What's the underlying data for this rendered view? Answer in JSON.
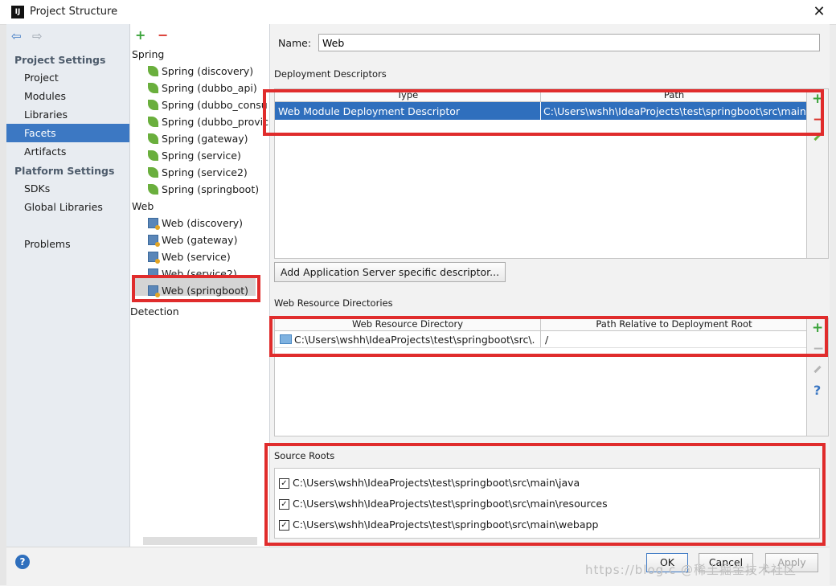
{
  "window": {
    "title": "Project Structure",
    "close_glyph": "✕",
    "app_icon_text": "IJ"
  },
  "nav": {
    "back_glyph": "⇦",
    "forward_glyph": "⇨",
    "project_settings_header": "Project Settings",
    "project_settings_items": [
      "Project",
      "Modules",
      "Libraries",
      "Facets",
      "Artifacts"
    ],
    "platform_settings_header": "Platform Settings",
    "platform_settings_items": [
      "SDKs",
      "Global Libraries"
    ],
    "problems": "Problems",
    "selected": "Facets"
  },
  "tree": {
    "add_glyph": "+",
    "remove_glyph": "−",
    "groups": [
      {
        "label": "Spring",
        "items": [
          "Spring (discovery)",
          "Spring (dubbo_api)",
          "Spring (dubbo_consu",
          "Spring (dubbo_provic",
          "Spring (gateway)",
          "Spring (service)",
          "Spring (service2)",
          "Spring (springboot)"
        ]
      },
      {
        "label": "Web",
        "items": [
          "Web (discovery)",
          "Web (gateway)",
          "Web (service)",
          "Web (service2)",
          "Web (springboot)"
        ]
      }
    ],
    "detection": "Detection",
    "selected": "Web (springboot)"
  },
  "facet": {
    "name_label": "Name:",
    "name_value": "Web",
    "deployment": {
      "title": "Deployment Descriptors",
      "columns": [
        "Type",
        "Path"
      ],
      "rows": [
        {
          "type": "Web Module Deployment Descriptor",
          "path": "C:\\Users\\wshh\\IdeaProjects\\test\\springboot\\src\\main\\we"
        }
      ],
      "add_server_button": "Add Application Server specific descriptor..."
    },
    "web_resources": {
      "title": "Web Resource Directories",
      "columns": [
        "Web Resource Directory",
        "Path Relative to Deployment Root"
      ],
      "rows": [
        {
          "dir": "C:\\Users\\wshh\\IdeaProjects\\test\\springboot\\src\\...",
          "rel": "/"
        }
      ],
      "help_glyph": "?"
    },
    "source_roots": {
      "title": "Source Roots",
      "items": [
        {
          "checked": true,
          "path": "C:\\Users\\wshh\\IdeaProjects\\test\\springboot\\src\\main\\java"
        },
        {
          "checked": true,
          "path": "C:\\Users\\wshh\\IdeaProjects\\test\\springboot\\src\\main\\resources"
        },
        {
          "checked": true,
          "path": "C:\\Users\\wshh\\IdeaProjects\\test\\springboot\\src\\main\\webapp"
        }
      ],
      "check_glyph": "✓"
    }
  },
  "footer": {
    "help_glyph": "?",
    "ok": "OK",
    "cancel": "Cancel",
    "apply": "Apply"
  },
  "watermark": "https://blog.c @稀土掘金技术社区",
  "colors": {
    "selection": "#3c78c3",
    "table_selection": "#2f6fbd",
    "highlight_box": "#e02c2c",
    "add": "#3aa33a",
    "remove": "#d9342b"
  }
}
